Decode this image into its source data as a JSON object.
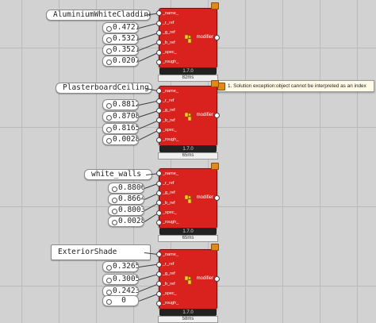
{
  "components": [
    {
      "name_panel": "AluminiumWhiteCladding",
      "values": [
        "0.4721",
        "0.5321",
        "0.3521",
        "0.0207"
      ],
      "inputs": [
        "_name_",
        "_r_ref",
        "_g_ref",
        "_b_ref",
        "_spec_",
        "_rough_"
      ],
      "output": "modifier",
      "version": "1.7.0",
      "time": "82ms"
    },
    {
      "name_panel": "PlasterboardCeiling",
      "values": [
        "0.8812",
        "0.8708",
        "0.8165",
        "0.0028"
      ],
      "inputs": [
        "_name_",
        "_r_ref",
        "_g_ref",
        "_b_ref",
        "_spec_",
        "_rough_"
      ],
      "output": "modifier",
      "version": "1.7.0",
      "time": "65ms"
    },
    {
      "name_panel": "white_walls",
      "values": [
        "0.8806",
        "0.8664",
        "0.8003",
        "0.0028"
      ],
      "inputs": [
        "_name_",
        "_r_ref",
        "_g_ref",
        "_b_ref",
        "_spec_",
        "_rough_"
      ],
      "output": "modifier",
      "version": "1.7.0",
      "time": "65ms"
    },
    {
      "name_panel": "ExteriorShade",
      "values": [
        "0.3265",
        "0.3005",
        "0.2423",
        "0"
      ],
      "inputs": [
        "_name_",
        "_r_ref",
        "_g_ref",
        "_b_ref",
        "_spec_",
        "_rough_"
      ],
      "output": "modifier",
      "version": "1.7.0",
      "time": "58ms"
    }
  ],
  "error_message": "1. Solution exception:object cannot be interpreted as an index",
  "colors": {
    "component": "#d9221e",
    "warning": "#e0891a",
    "canvas": "#d2d2d2"
  },
  "icons": {
    "component_logo": "honeybee-icon",
    "warning_flag": "warning-flag-icon"
  }
}
